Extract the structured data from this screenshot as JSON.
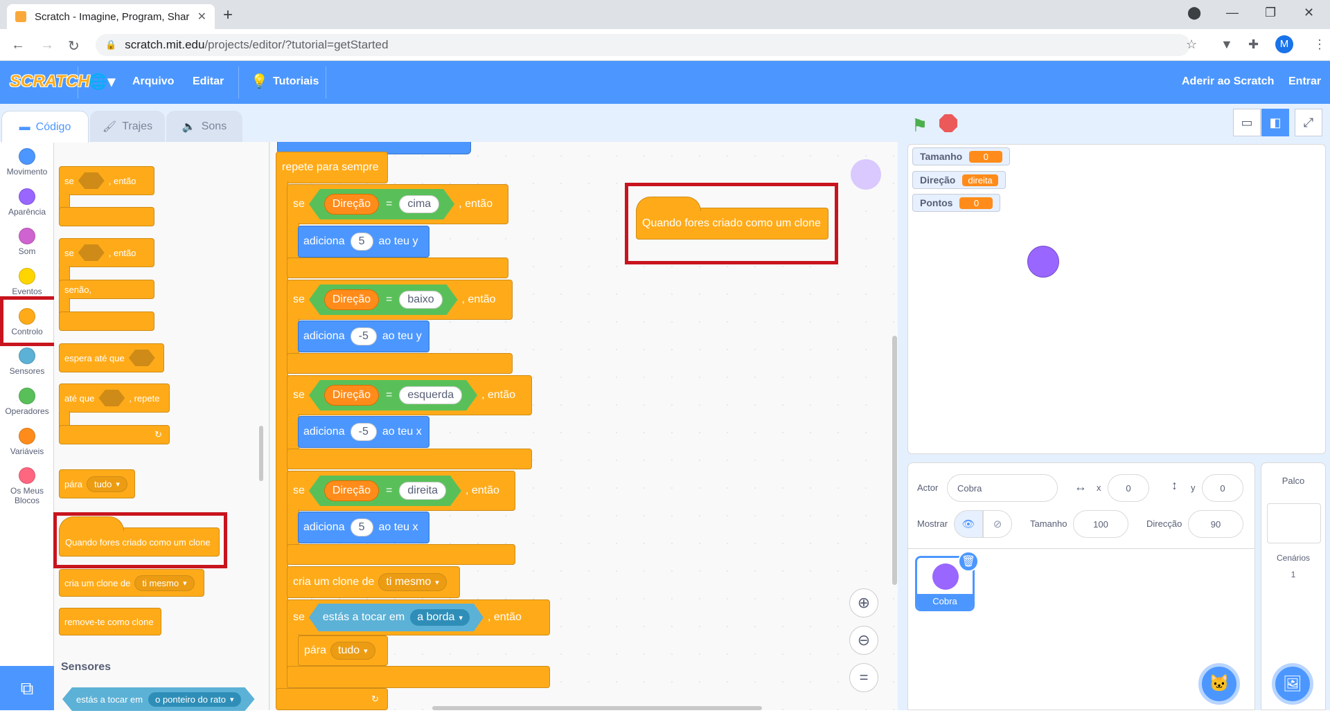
{
  "browser": {
    "tab_title": "Scratch - Imagine, Program, Shar",
    "url_host": "scratch.mit.edu",
    "url_path": "/projects/editor/?tutorial=getStarted",
    "avatar_letter": "M"
  },
  "menu": {
    "logo": "SCRATCH",
    "file": "Arquivo",
    "edit": "Editar",
    "tutorials": "Tutoriais",
    "join": "Aderir ao Scratch",
    "signin": "Entrar"
  },
  "tabs": {
    "code": "Código",
    "costumes": "Trajes",
    "sounds": "Sons"
  },
  "categories": [
    {
      "label": "Movimento",
      "color": "#4c97ff"
    },
    {
      "label": "Aparência",
      "color": "#9966ff"
    },
    {
      "label": "Som",
      "color": "#cf63cf"
    },
    {
      "label": "Eventos",
      "color": "#ffd500"
    },
    {
      "label": "Controlo",
      "color": "#ffab19"
    },
    {
      "label": "Sensores",
      "color": "#5cb1d6"
    },
    {
      "label": "Operadores",
      "color": "#59c059"
    },
    {
      "label": "Variáveis",
      "color": "#ff8c1a"
    },
    {
      "label": "Os Meus Blocos",
      "color": "#ff6680"
    }
  ],
  "palette": {
    "if_label": "se",
    "then_label": ", então",
    "else_label": "senão,",
    "wait_until": "espera até que",
    "repeat_until": "até que",
    "repeat_label": ", repete",
    "stop_label": "pára",
    "stop_option": "tudo",
    "when_clone": "Quando fores criado como um clone",
    "create_clone": "cria um clone de",
    "create_clone_option": "ti mesmo",
    "delete_clone": "remove-te como clone",
    "sensing_heading": "Sensores",
    "touching_label": "estás a tocar em",
    "touching_option": "o ponteiro do rato"
  },
  "script": {
    "forever": "repete para sempre",
    "if": "se",
    "then": ", então",
    "direction_var": "Direção",
    "equals": "=",
    "change": "adiciona",
    "to_y": "ao teu y",
    "to_x": "ao teu x",
    "cond1_value": "cima",
    "cond1_amount": "5",
    "cond2_value": "baixo",
    "cond2_amount": "-5",
    "cond3_value": "esquerda",
    "cond3_amount": "-5",
    "cond4_value": "direita",
    "cond4_amount": "5",
    "create_clone": "cria um clone de",
    "clone_option": "ti mesmo",
    "touching": "estás a tocar em",
    "touching_option": "a borda",
    "stop": "pára",
    "stop_option": "tudo",
    "hat_clone": "Quando fores criado como um clone"
  },
  "monitors": [
    {
      "name": "Tamanho",
      "value": "0"
    },
    {
      "name": "Direção",
      "value": "direita"
    },
    {
      "name": "Pontos",
      "value": "0"
    }
  ],
  "sprite_info": {
    "actor_label": "Actor",
    "actor_name": "Cobra",
    "x_label": "x",
    "x_value": "0",
    "y_label": "y",
    "y_value": "0",
    "show_label": "Mostrar",
    "size_label": "Tamanho",
    "size_value": "100",
    "direction_label": "Direcção",
    "direction_value": "90",
    "sprite_name": "Cobra"
  },
  "stage_pane": {
    "title": "Palco",
    "backdrops_label": "Cenários",
    "backdrops_count": "1"
  },
  "colors": {
    "accent": "#4c97ff",
    "control": "#ffab19",
    "highlight": "#c8141e"
  }
}
